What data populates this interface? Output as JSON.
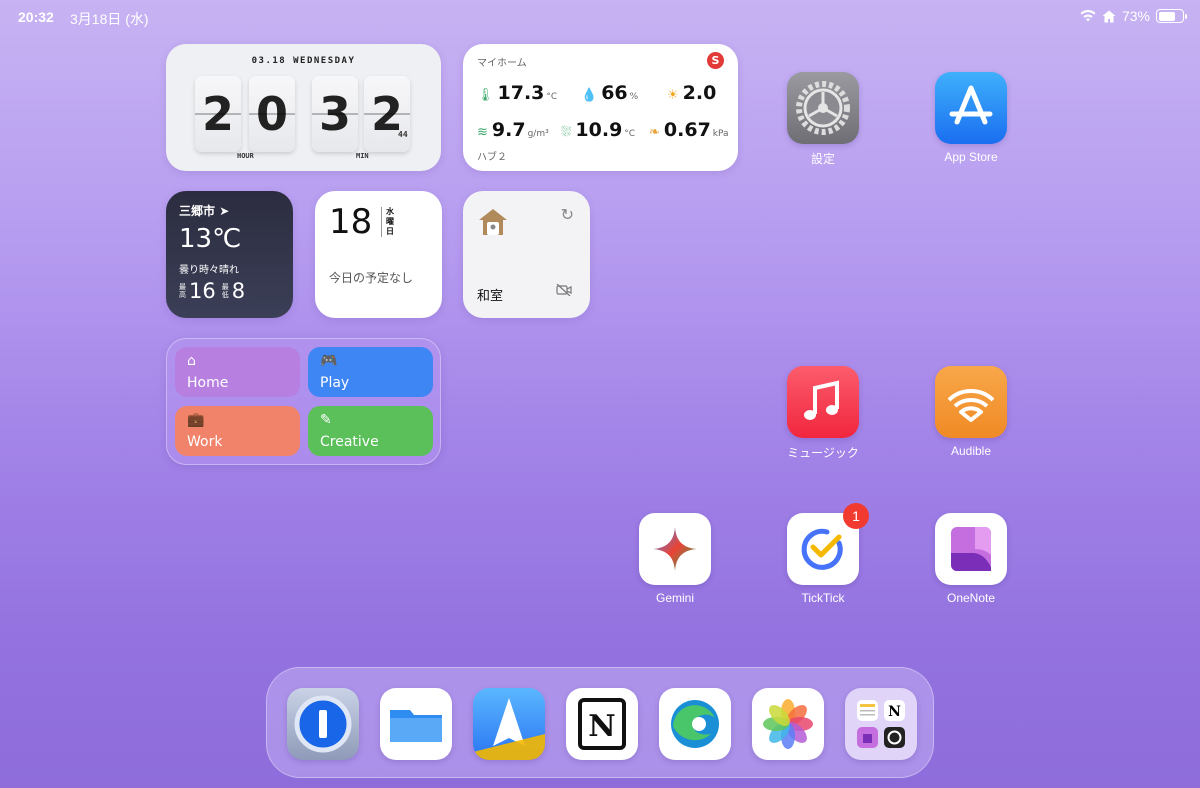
{
  "status_bar": {
    "time": "20:32",
    "date": "3月18日 (水)",
    "battery": "73%",
    "battery_level": 0.73
  },
  "clock_widget": {
    "date": "03.18 WEDNESDAY",
    "digits": [
      "2",
      "0",
      "3",
      "2"
    ],
    "seconds": "44",
    "hour_label": "HOUR",
    "min_label": "MIN"
  },
  "sensor_widget": {
    "title": "マイホーム",
    "hub": "ハブ２",
    "badge": "S",
    "readings": [
      {
        "value": "17.3",
        "unit": "°C"
      },
      {
        "value": "66",
        "unit": "%"
      },
      {
        "value": "2.0",
        "unit": ""
      },
      {
        "value": "9.7",
        "unit": "g/m³"
      },
      {
        "value": "10.9",
        "unit": "°C"
      },
      {
        "value": "0.67",
        "unit": "kPa"
      }
    ]
  },
  "weather_widget": {
    "city": "三郷市",
    "temp": "13℃",
    "condition": "曇り時々晴れ",
    "high_label": "最高",
    "high": "16",
    "low_label": "最低",
    "low": "8"
  },
  "calendar_widget": {
    "day": "18",
    "weekday": [
      "水",
      "曜",
      "日"
    ],
    "events": "今日の予定なし"
  },
  "camera_widget": {
    "room": "和室"
  },
  "shortcuts": [
    {
      "label": "Home",
      "color": "#b77fe0"
    },
    {
      "label": "Play",
      "color": "#3f86f5"
    },
    {
      "label": "Work",
      "color": "#f0836a"
    },
    {
      "label": "Creative",
      "color": "#5bbf5a"
    }
  ],
  "apps": {
    "settings": "設定",
    "appstore": "App Store",
    "music": "ミュージック",
    "audible": "Audible",
    "gemini": "Gemini",
    "ticktick": "TickTick",
    "ticktick_badge": "1",
    "onenote": "OneNote"
  },
  "dock": {
    "apps": [
      "1Password",
      "Files",
      "Spark",
      "Notion",
      "Edge",
      "Photos",
      "Folder"
    ]
  }
}
